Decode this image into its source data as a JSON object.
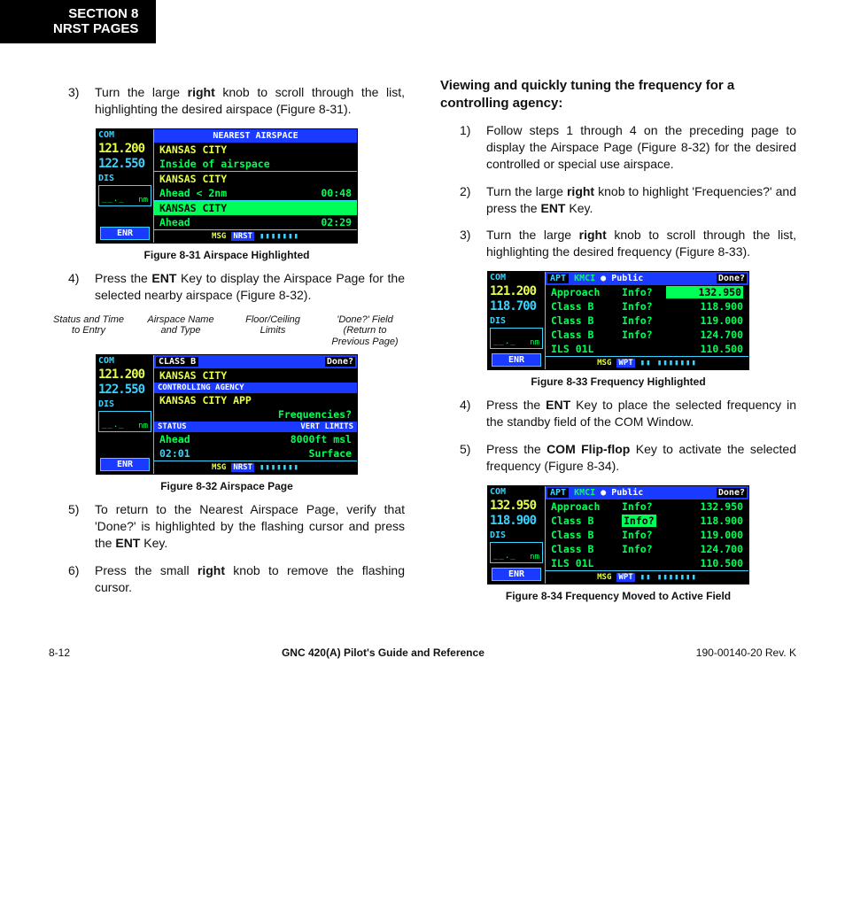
{
  "section": {
    "line1": "SECTION 8",
    "line2": "NRST PAGES"
  },
  "leftCol": {
    "step3": {
      "num": "3)",
      "text_before": "Turn the large ",
      "b1": "right",
      "text_after": " knob to scroll through the list, highlighting the desired airspace (Figure 8-31)."
    },
    "fig31": {
      "caption": "Figure 8-31  Airspace Highlighted",
      "side": {
        "com": "COM",
        "f1": "121.200",
        "f2": "122.550",
        "dis": "DIS",
        "nm": "nm",
        "enr": "ENR"
      },
      "title": "NEAREST AIRSPACE",
      "rows": [
        {
          "name": "KANSAS CITY",
          "status": "Inside of airspace",
          "time": ""
        },
        {
          "name": "KANSAS CITY",
          "status": "Ahead < 2nm",
          "time": "00:48"
        },
        {
          "name": "KANSAS CITY",
          "status": "Ahead",
          "time": "02:29",
          "sel": true
        }
      ],
      "msg": "MSG",
      "grp": "NRST"
    },
    "step4": {
      "num": "4)",
      "before": "Press the ",
      "b1": "ENT",
      "after": " Key to display the Airspace Page for the selected nearby airspace (Figure 8-32)."
    },
    "annot": [
      "Status and Time to Entry",
      "Airspace Name and Type",
      "Floor/Ceiling Limits",
      "'Done?' Field (Return to Previous Page)"
    ],
    "fig32": {
      "caption": "Figure 8-32  Airspace Page",
      "side": {
        "com": "COM",
        "f1": "121.200",
        "f2": "122.550",
        "dis": "DIS",
        "nm": "nm",
        "enr": "ENR"
      },
      "title": {
        "classb": "CLASS B",
        "done": "Done?"
      },
      "rows": {
        "name": "KANSAS CITY",
        "ctrllbl": "CONTROLLING AGENCY",
        "ctrl": "KANSAS CITY APP",
        "freqq": "Frequencies?",
        "statlbl": "STATUS",
        "vertlbl": "VERT LIMITS",
        "status": "Ahead",
        "fl": "8000ft msl",
        "time": "02:01",
        "ce": "Surface"
      },
      "msg": "MSG",
      "grp": "NRST"
    },
    "step5": {
      "num": "5)",
      "before": "To return to the Nearest Airspace Page, verify that 'Done?' is highlighted by the flashing cursor and press the ",
      "b1": "ENT",
      "after": " Key."
    },
    "step6": {
      "num": "6)",
      "before": "Press the small ",
      "b1": "right",
      "after": " knob to remove the flashing cursor."
    }
  },
  "rightCol": {
    "subhead": "Viewing and quickly tuning the frequency for a controlling agency:",
    "step1": {
      "num": "1)",
      "text": "Follow steps 1 through 4 on the preceding page to display the Airspace Page (Figure 8-32) for the desired controlled or special use airspace."
    },
    "step2": {
      "num": "2)",
      "before": "Turn the large ",
      "b1": "right",
      "mid": " knob to highlight 'Frequencies?' and press the ",
      "b2": "ENT",
      "after": " Key."
    },
    "step3": {
      "num": "3)",
      "before": "Turn the large ",
      "b1": "right",
      "after": " knob to scroll through the list, highlighting the desired frequency (Figure 8-33)."
    },
    "fig33": {
      "caption": "Figure 8-33  Frequency Highlighted",
      "side": {
        "com": "COM",
        "f1": "121.200",
        "f2": "118.700",
        "dis": "DIS",
        "nm": "nm",
        "enr": "ENR"
      },
      "title": {
        "apt": "APT",
        "id": "KMCI",
        "pub": "● Public",
        "done": "Done?"
      },
      "rows": [
        {
          "t": "Approach",
          "i": "Info?",
          "f": "132.950",
          "hl": true
        },
        {
          "t": "Class B",
          "i": "Info?",
          "f": "118.900"
        },
        {
          "t": "Class B",
          "i": "Info?",
          "f": "119.000"
        },
        {
          "t": "Class B",
          "i": "Info?",
          "f": "124.700"
        },
        {
          "t": "ILS 01L",
          "i": "",
          "f": "110.500"
        }
      ],
      "msg": "MSG",
      "grp": "WPT"
    },
    "step4": {
      "num": "4)",
      "before": "Press the ",
      "b1": "ENT",
      "after": " Key to place the selected frequency in the standby field of the COM Window."
    },
    "step5": {
      "num": "5)",
      "before": "Press the ",
      "b1": "COM Flip-flop",
      "after": " Key to activate the selected frequency (Figure 8-34)."
    },
    "fig34": {
      "caption": "Figure 8-34  Frequency Moved to Active Field",
      "side": {
        "com": "COM",
        "f1": "132.950",
        "f2": "118.900",
        "dis": "DIS",
        "nm": "nm",
        "enr": "ENR"
      },
      "title": {
        "apt": "APT",
        "id": "KMCI",
        "pub": "● Public",
        "done": "Done?"
      },
      "rows": [
        {
          "t": "Approach",
          "i": "Info?",
          "f": "132.950"
        },
        {
          "t": "Class B",
          "i": "Info?",
          "f": "118.900",
          "iinv": true
        },
        {
          "t": "Class B",
          "i": "Info?",
          "f": "119.000"
        },
        {
          "t": "Class B",
          "i": "Info?",
          "f": "124.700"
        },
        {
          "t": "ILS 01L",
          "i": "",
          "f": "110.500"
        }
      ],
      "msg": "MSG",
      "grp": "WPT"
    }
  },
  "footer": {
    "left": "8-12",
    "center": "GNC 420(A) Pilot's Guide and Reference",
    "right": "190-00140-20  Rev. K"
  }
}
